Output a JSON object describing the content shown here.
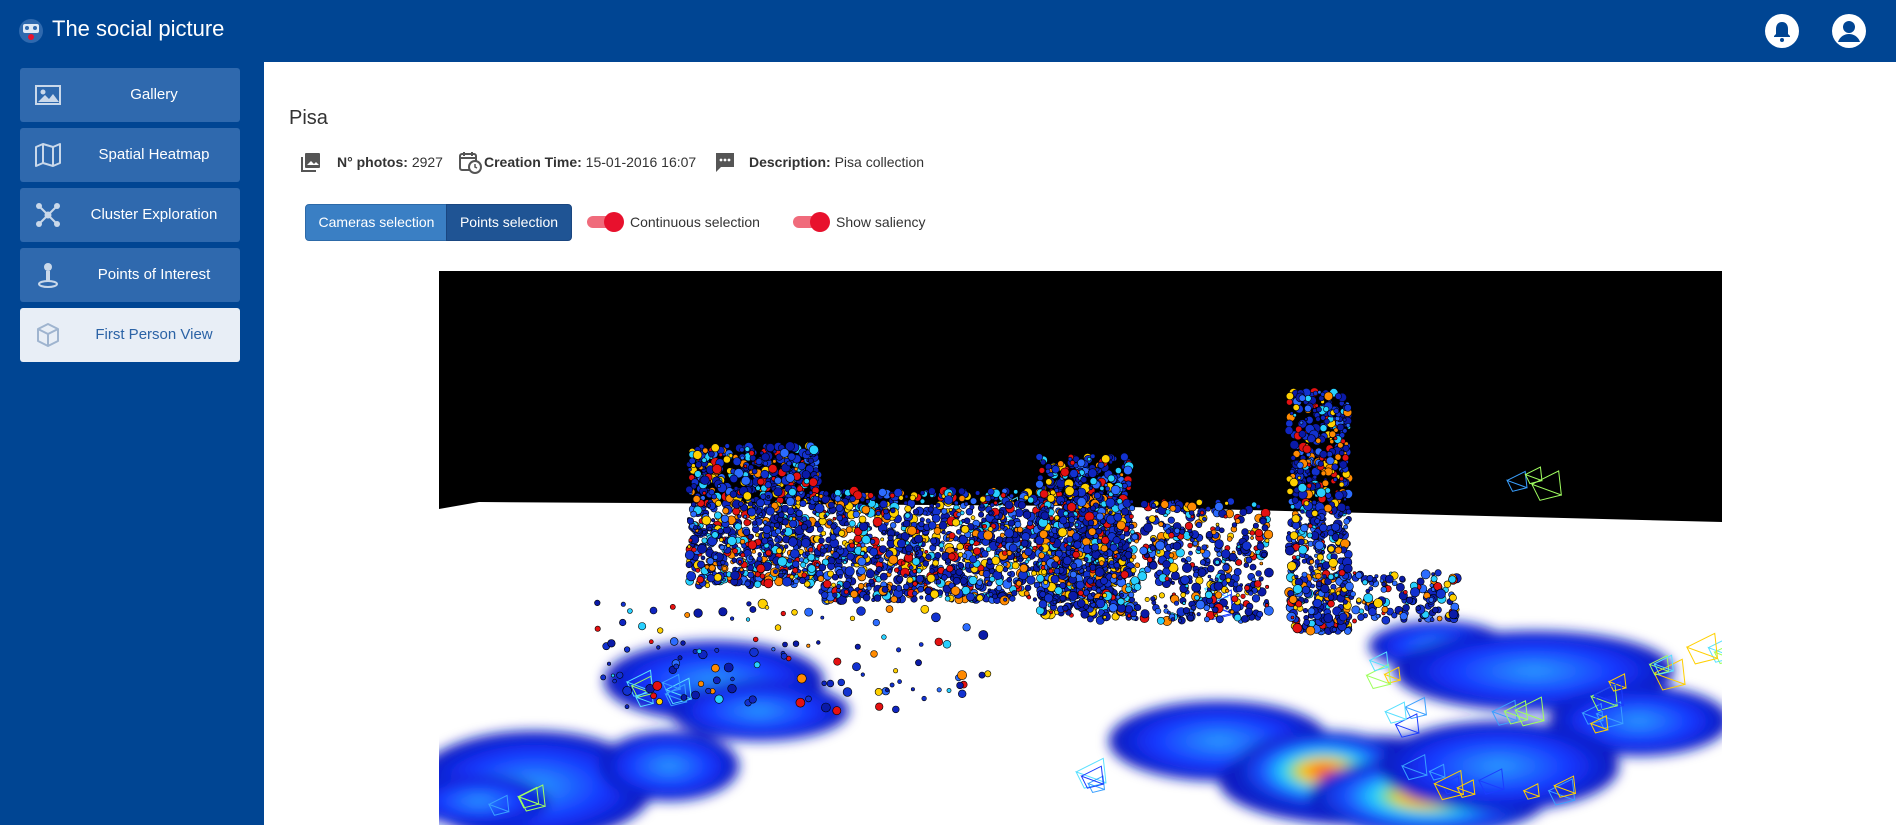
{
  "app": {
    "title": "The social picture",
    "logo_icon": "app-logo-icon",
    "brand_color": "#004593"
  },
  "header": {
    "notification_icon": "bell-icon",
    "user_icon": "account-icon"
  },
  "sidebar": {
    "items": [
      {
        "label": "Gallery",
        "icon": "image-icon",
        "active": false
      },
      {
        "label": "Spatial Heatmap",
        "icon": "map-icon",
        "active": false
      },
      {
        "label": "Cluster Exploration",
        "icon": "cluster-icon",
        "active": false
      },
      {
        "label": "Points of Interest",
        "icon": "poi-pin-icon",
        "active": false
      },
      {
        "label": "First Person View",
        "icon": "cube-icon",
        "active": true
      }
    ]
  },
  "collection": {
    "title": "Pisa",
    "photos_label": "N° photos:",
    "photos_value": "2927",
    "creation_label": "Creation Time:",
    "creation_value": "15-01-2016 16:07",
    "description_label": "Description:",
    "description_value": "Pisa collection"
  },
  "controls": {
    "cameras_selection": "Cameras selection",
    "points_selection": "Points selection",
    "continuous_selection": {
      "label": "Continuous selection",
      "on": true
    },
    "show_saliency": {
      "label": "Show saliency",
      "on": true
    },
    "accent_color": "#e8112d"
  },
  "viewer": {
    "description_icon": "point-cloud-3d-view"
  }
}
